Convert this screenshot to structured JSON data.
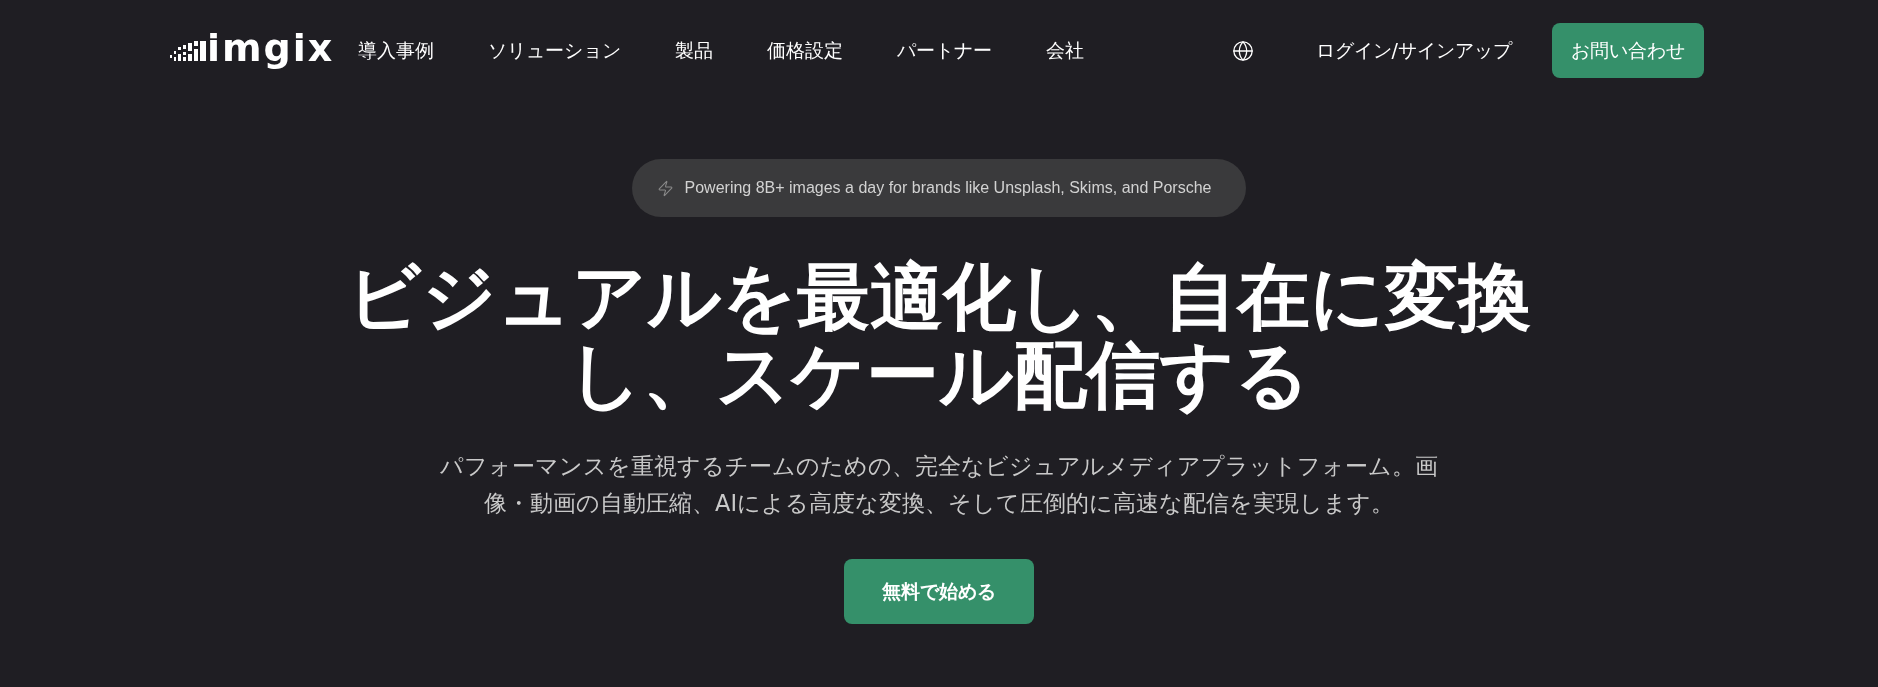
{
  "header": {
    "logo": {
      "text": "imgix"
    },
    "nav_links": [
      "導入事例",
      "ソリューション",
      "製品",
      "価格設定",
      "パートナー",
      "会社"
    ],
    "login_link": "ログイン/サインアップ",
    "contact_button": "お問い合わせ"
  },
  "hero": {
    "badge": "Powering 8B+ images a day for brands like Unsplash, Skims, and Porsche",
    "headline": "ビジュアルを最適化し、自在に変換し、スケール配信する",
    "subtitle": "パフォーマンスを重視するチームのための、完全なビジュアルメディアプラットフォーム。画像・動画の自動圧縮、AIによる高度な変換、そして圧倒的に高速な配信を実現します。",
    "cta_button": "無料で始める"
  }
}
